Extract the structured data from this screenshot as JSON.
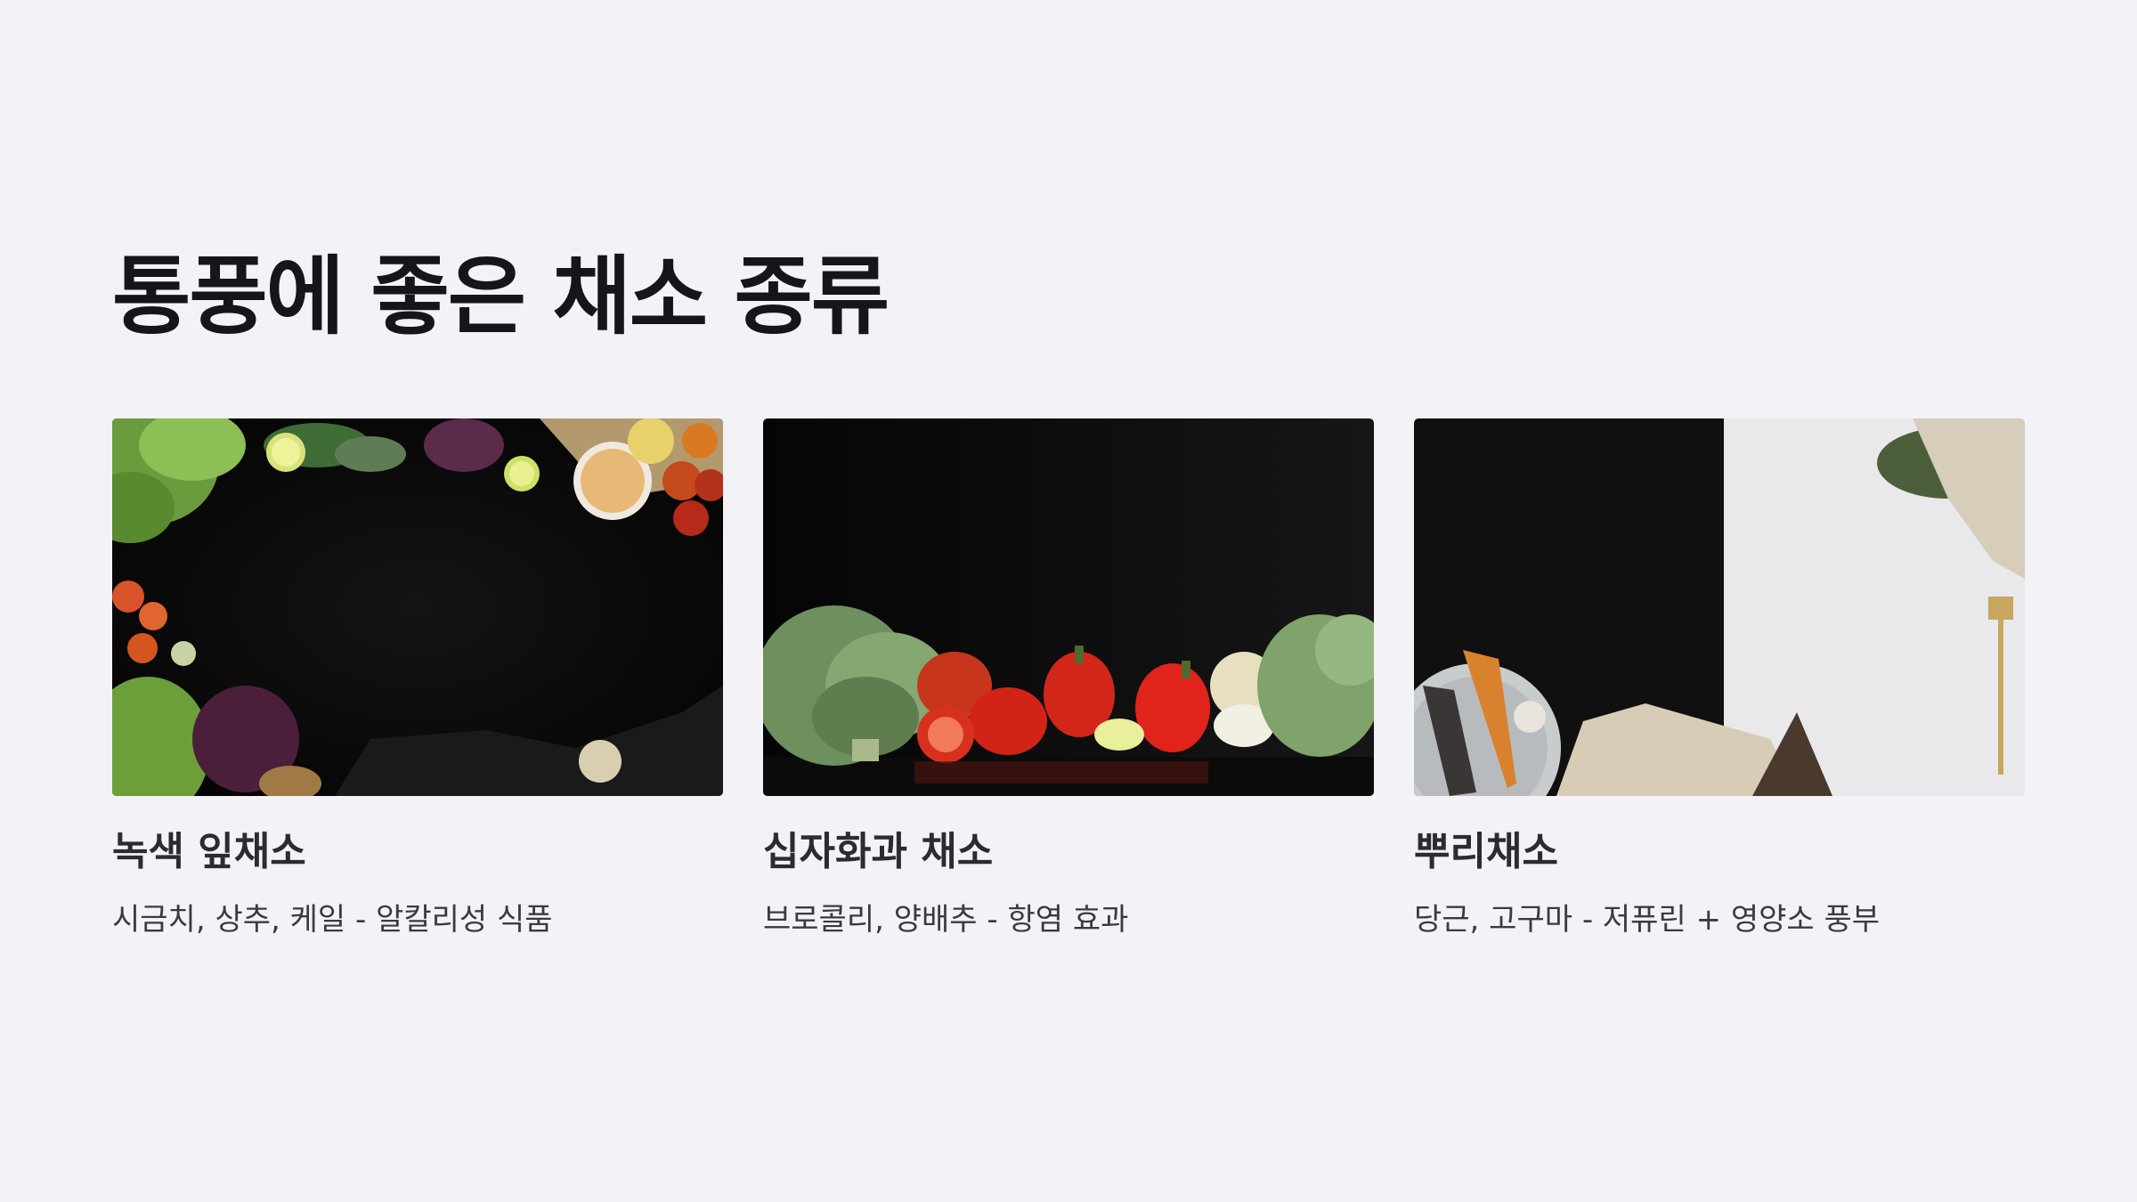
{
  "slide": {
    "title": "통풍에 좋은 채소 종류"
  },
  "cards": [
    {
      "title": "녹색 잎채소",
      "description": "시금치, 상추, 케일 - 알칼리성 식품"
    },
    {
      "title": "십자화과 채소",
      "description": "브로콜리, 양배추 - 항염 효과"
    },
    {
      "title": "뿌리채소",
      "description": "당근, 고구마 - 저퓨린 + 영양소 풍부"
    }
  ]
}
